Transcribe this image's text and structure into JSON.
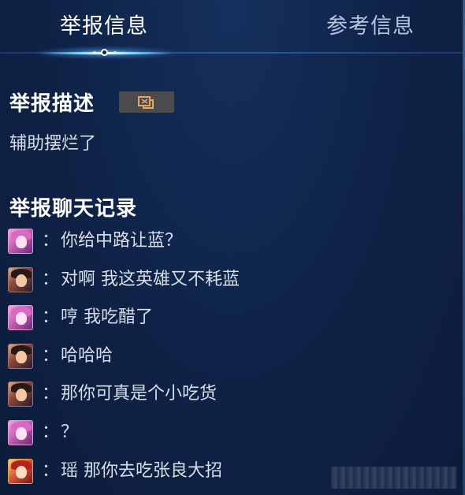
{
  "tabs": [
    {
      "label": "举报信息",
      "active": true
    },
    {
      "label": "参考信息",
      "active": false
    }
  ],
  "report_description": {
    "heading": "举报描述",
    "text": "辅助摆烂了"
  },
  "chat_log": {
    "heading": "举报聊天记录",
    "separator": "：",
    "messages": [
      {
        "avatar": "pink-hero-avatar",
        "text": "你给中路让蓝？"
      },
      {
        "avatar": "dark-hair-hero-avatar",
        "text": "对啊 我这英雄又不耗蓝"
      },
      {
        "avatar": "pink-hero-avatar",
        "text": "哼 我吃醋了"
      },
      {
        "avatar": "dark-hair-hero-avatar",
        "text": "哈哈哈"
      },
      {
        "avatar": "dark-hair-hero-avatar",
        "text": "那你可真是个小吃货"
      },
      {
        "avatar": "pink-hero-avatar",
        "text": "？"
      },
      {
        "avatar": "red-hero-avatar",
        "text": "瑶 那你去吃张良大招"
      }
    ]
  },
  "colors": {
    "background": "#0f2246",
    "active_tab_text": "#ffffff",
    "inactive_tab_text": "#b7c4de",
    "indicator_glow": "#7fd4ff",
    "copy_button_bg": "#4b4a4c",
    "copy_icon": "#e0a86a"
  }
}
